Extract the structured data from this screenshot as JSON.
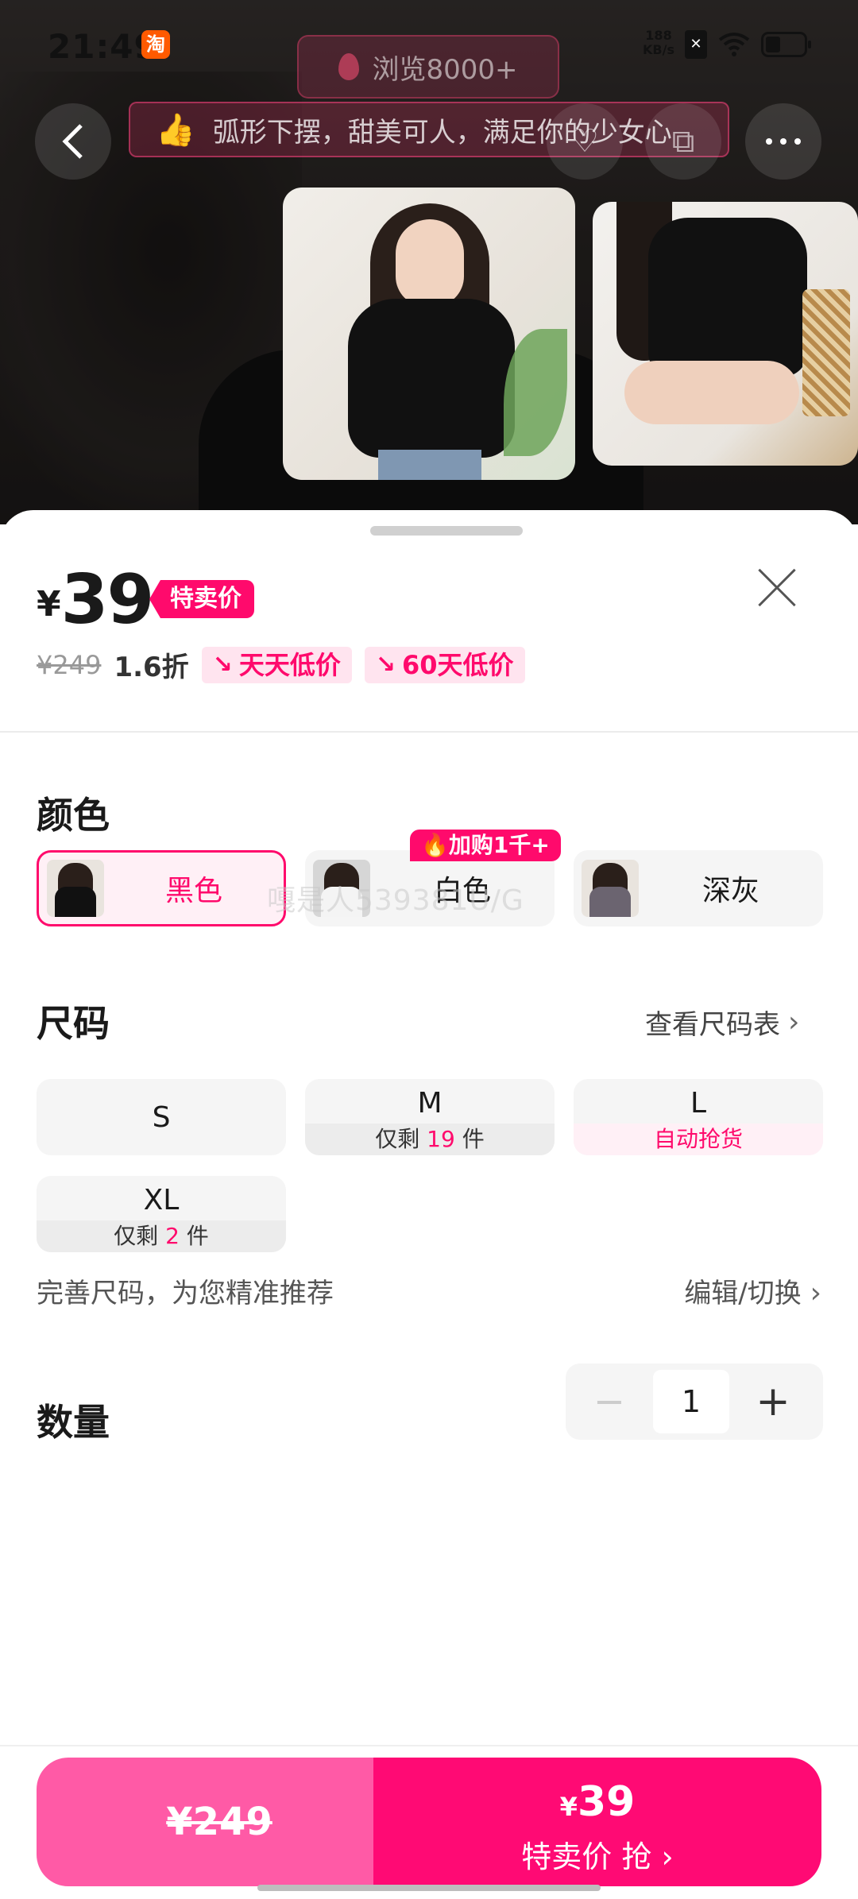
{
  "status_bar": {
    "time": "21:49",
    "app_badge": "淘",
    "net_speed_value": "188",
    "net_speed_unit": "KB/s"
  },
  "overlay": {
    "views": "浏览8000+",
    "banner": "弧形下摆，甜美可人，满足你的少女心"
  },
  "price": {
    "currency": "¥",
    "current": "39",
    "deal_tag": "特卖价",
    "original": "¥249",
    "discount": "1.6折",
    "tags": [
      "天天低价",
      "60天低价"
    ]
  },
  "color": {
    "title": "颜色",
    "options": [
      {
        "label": "黑色",
        "selected": true,
        "shirt": "#111111"
      },
      {
        "label": "白色",
        "selected": false,
        "shirt": "#f4f4f4"
      },
      {
        "label": "深灰",
        "selected": false,
        "shirt": "#6b6470"
      }
    ],
    "hot_badge": "加购1千+",
    "watermark": "嘎是人539381U/G"
  },
  "size": {
    "title": "尺码",
    "chart_link": "查看尺码表",
    "options": [
      {
        "name": "S"
      },
      {
        "name": "M",
        "sub_prefix": "仅剩 ",
        "sub_num": "19",
        "sub_suffix": " 件"
      },
      {
        "name": "L",
        "sub": "自动抢货"
      },
      {
        "name": "XL",
        "sub_prefix": "仅剩 ",
        "sub_num": "2",
        "sub_suffix": " 件"
      }
    ],
    "hint": "完善尺码，为您精准推荐",
    "hint_action": "编辑/切换"
  },
  "quantity": {
    "title": "数量",
    "value": "1"
  },
  "bottom": {
    "left_price": "¥249",
    "right_currency": "¥",
    "right_price": "39",
    "right_text": "特卖价 抢"
  },
  "colors": {
    "accent": "#ff0a6c",
    "accent_light": "#ff5aa6"
  }
}
